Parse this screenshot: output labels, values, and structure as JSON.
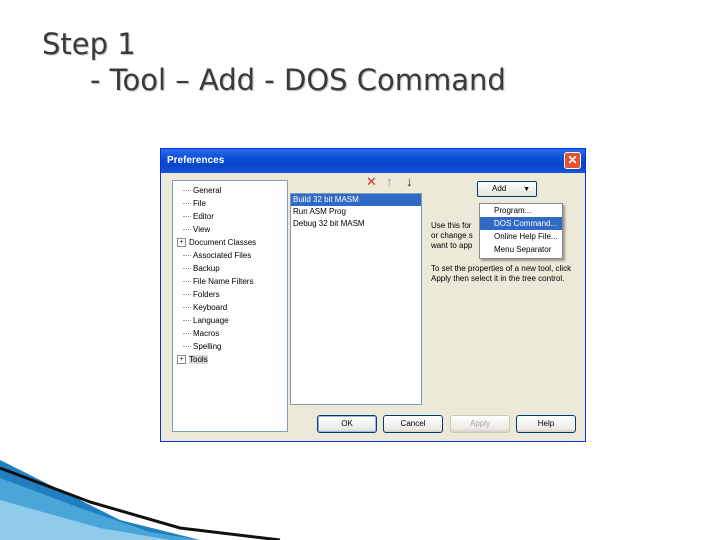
{
  "slide": {
    "title": "Step 1",
    "subtitle": "- Tool – Add - DOS Command"
  },
  "dialog": {
    "title": "Preferences",
    "close_glyph": "✕",
    "tree": [
      {
        "label": "General",
        "expandable": false
      },
      {
        "label": "File",
        "expandable": false
      },
      {
        "label": "Editor",
        "expandable": false
      },
      {
        "label": "View",
        "expandable": false
      },
      {
        "label": "Document Classes",
        "expandable": true
      },
      {
        "label": "Associated Files",
        "expandable": false
      },
      {
        "label": "Backup",
        "expandable": false
      },
      {
        "label": "File Name Filters",
        "expandable": false
      },
      {
        "label": "Folders",
        "expandable": false
      },
      {
        "label": "Keyboard",
        "expandable": false
      },
      {
        "label": "Language",
        "expandable": false
      },
      {
        "label": "Macros",
        "expandable": false
      },
      {
        "label": "Spelling",
        "expandable": false
      },
      {
        "label": "Tools",
        "expandable": true,
        "selected": true
      }
    ],
    "tools": [
      {
        "label": "Build 32 bit MASM",
        "selected": true
      },
      {
        "label": "Run ASM Prog",
        "selected": false
      },
      {
        "label": "Debug 32 bit MASM",
        "selected": false
      }
    ],
    "toolbar": {
      "delete_glyph": "✕",
      "up_glyph": "↑",
      "down_glyph": "↓",
      "delete_color": "#d03a2a",
      "up_color": "#9a9a9a",
      "down_color": "#202020"
    },
    "add_button": {
      "label": "Add",
      "caret": "▼"
    },
    "add_menu": [
      {
        "label": "Program...",
        "active": false
      },
      {
        "label": "DOS Command...",
        "active": true
      },
      {
        "label": "Online Help File...",
        "active": false
      },
      {
        "label": "Menu Separator",
        "active": false
      }
    ],
    "description_partial": [
      "Use this for",
      "or change s",
      "want to app"
    ],
    "description": "To set the properties of a new tool, click Apply then select it in the tree control.",
    "buttons": {
      "ok": "OK",
      "cancel": "Cancel",
      "apply": "Apply",
      "help": "Help"
    }
  },
  "colors": {
    "selection": "#316ac5",
    "titlebar": "#0a4dd6",
    "dialog_bg": "#ece9d8"
  }
}
